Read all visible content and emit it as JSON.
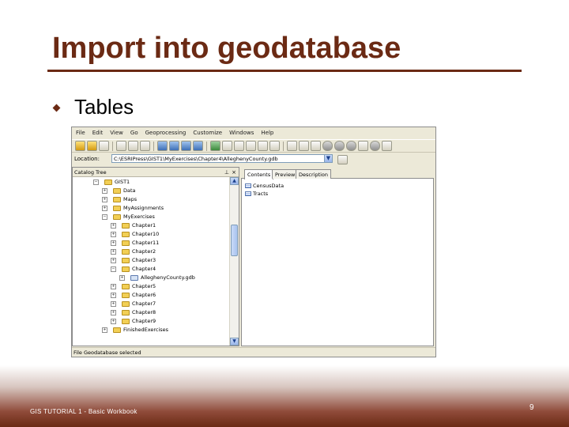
{
  "slide": {
    "title": "Import into geodatabase",
    "bullet": "Tables",
    "footer": "GIS TUTORIAL 1 - Basic Workbook",
    "page_number": "9"
  },
  "colors": {
    "title": "#6b2a14",
    "footer_dark": "#6b2a14",
    "window_chrome": "#ece9d8"
  },
  "app": {
    "menu": [
      "File",
      "Edit",
      "View",
      "Go",
      "Geoprocessing",
      "Customize",
      "Windows",
      "Help"
    ],
    "location_label": "Location:",
    "location_value": "C:\\ESRIPress\\GIST1\\MyExercises\\Chapter4\\AlleghenyCounty.gdb",
    "catalog_tree": {
      "header": "Catalog Tree",
      "items": [
        {
          "label": "GIST1",
          "level": 0,
          "expander": "−",
          "icon": "folder"
        },
        {
          "label": "Data",
          "level": 1,
          "expander": "+",
          "icon": "folder"
        },
        {
          "label": "Maps",
          "level": 1,
          "expander": "+",
          "icon": "folder"
        },
        {
          "label": "MyAssignments",
          "level": 1,
          "expander": "+",
          "icon": "folder"
        },
        {
          "label": "MyExercises",
          "level": 1,
          "expander": "−",
          "icon": "folder"
        },
        {
          "label": "Chapter1",
          "level": 2,
          "expander": "+",
          "icon": "folder"
        },
        {
          "label": "Chapter10",
          "level": 2,
          "expander": "+",
          "icon": "folder"
        },
        {
          "label": "Chapter11",
          "level": 2,
          "expander": "+",
          "icon": "folder"
        },
        {
          "label": "Chapter2",
          "level": 2,
          "expander": "+",
          "icon": "folder"
        },
        {
          "label": "Chapter3",
          "level": 2,
          "expander": "+",
          "icon": "folder"
        },
        {
          "label": "Chapter4",
          "level": 2,
          "expander": "−",
          "icon": "folder"
        },
        {
          "label": "AlleghenyCounty.gdb",
          "level": 3,
          "expander": "+",
          "icon": "geodatabase"
        },
        {
          "label": "Chapter5",
          "level": 2,
          "expander": "+",
          "icon": "folder"
        },
        {
          "label": "Chapter6",
          "level": 2,
          "expander": "+",
          "icon": "folder"
        },
        {
          "label": "Chapter7",
          "level": 2,
          "expander": "+",
          "icon": "folder"
        },
        {
          "label": "Chapter8",
          "level": 2,
          "expander": "+",
          "icon": "folder"
        },
        {
          "label": "Chapter9",
          "level": 2,
          "expander": "+",
          "icon": "folder"
        },
        {
          "label": "FinishedExercises",
          "level": 1,
          "expander": "+",
          "icon": "folder"
        }
      ]
    },
    "tabs": [
      "Contents",
      "Preview",
      "Description"
    ],
    "active_tab": "Contents",
    "contents": [
      {
        "label": "CensusData",
        "icon": "table-icon"
      },
      {
        "label": "Tracts",
        "icon": "table-icon"
      }
    ],
    "status": "File Geodatabase selected"
  }
}
